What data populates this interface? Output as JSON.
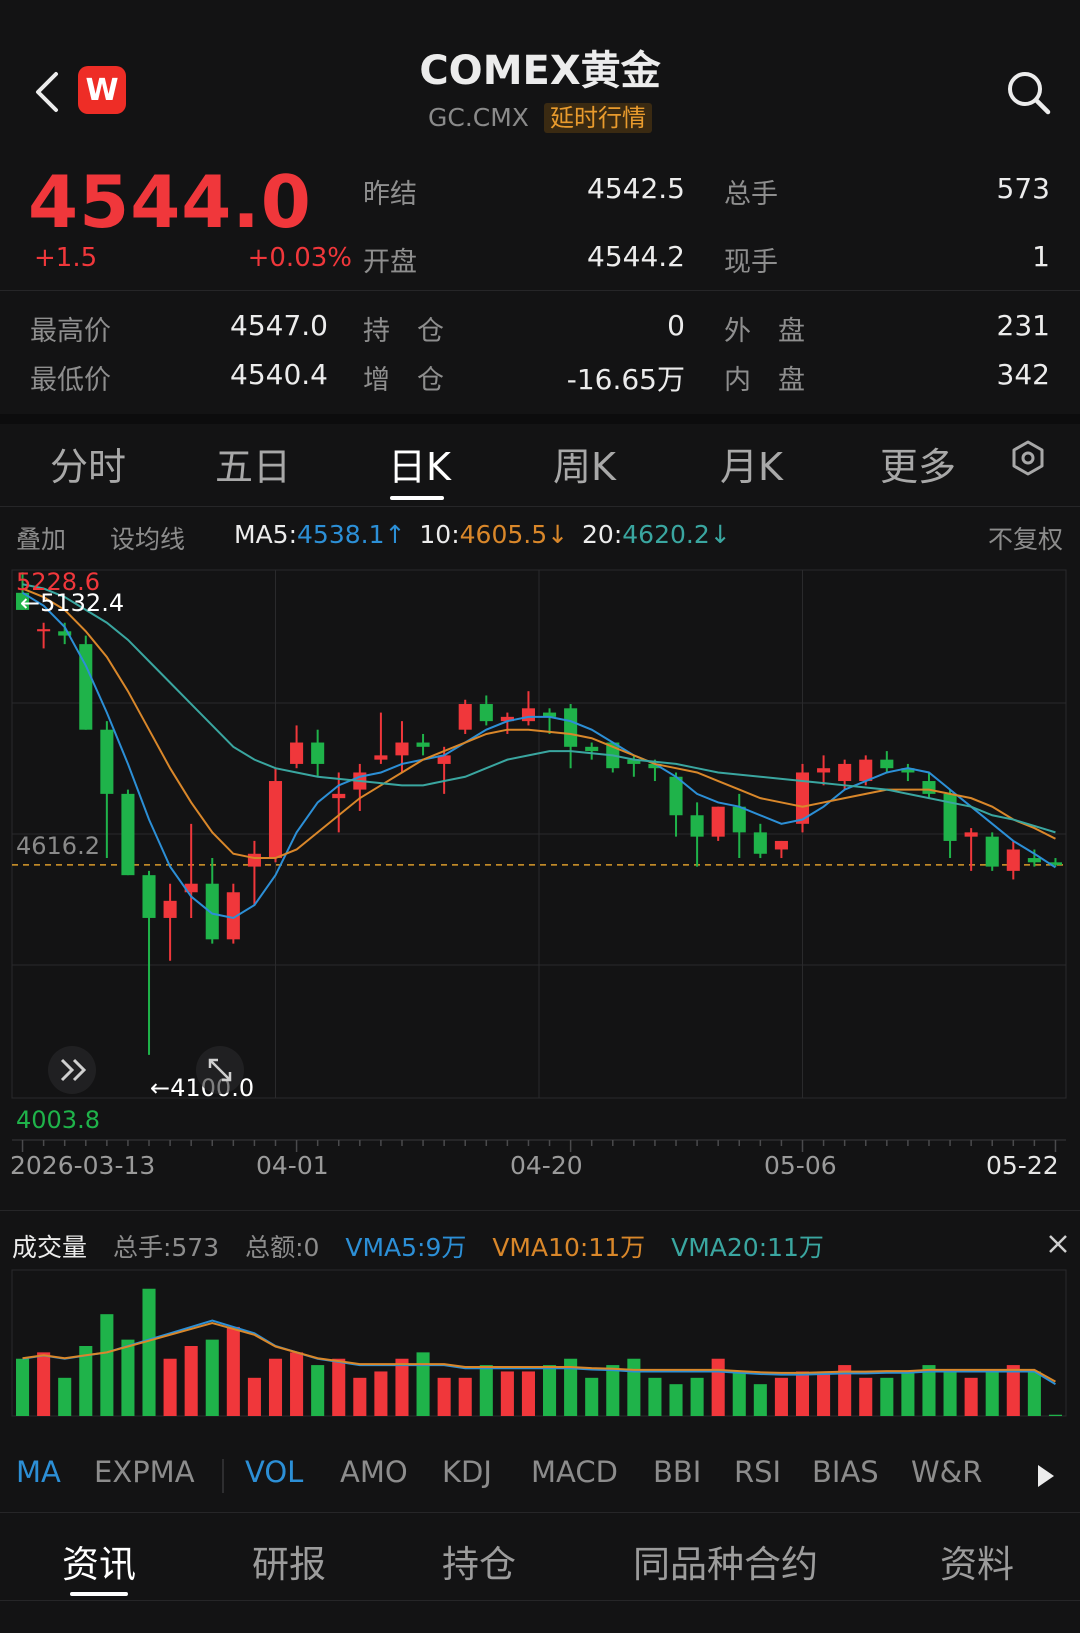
{
  "header": {
    "title": "COMEX黄金",
    "code": "GC.CMX",
    "delay_tag": "延时行情",
    "logo_letter": "W",
    "back_icon": "back-arrow-icon",
    "search_icon": "search-icon"
  },
  "quote": {
    "price": "4544.0",
    "change": "+1.5",
    "change_pct": "+0.03%",
    "rows": [
      {
        "l1": "昨结",
        "v1": "4542.5",
        "l2": "总手",
        "v2": "573"
      },
      {
        "l1": "开盘",
        "v1": "4544.2",
        "l2": "现手",
        "v2": "1"
      }
    ],
    "rows2": [
      {
        "l0": "最高价",
        "v0": "4547.0",
        "l1": "持　仓",
        "v1": "0",
        "l2": "外　盘",
        "v2": "231"
      },
      {
        "l0": "最低价",
        "v0": "4540.4",
        "l1": "增　仓",
        "v1": "-16.65万",
        "l2": "内　盘",
        "v2": "342"
      }
    ]
  },
  "tabs": [
    "分时",
    "五日",
    "日K",
    "周K",
    "月K",
    "更多"
  ],
  "active_tab": "日K",
  "ma_bar": {
    "overlay": "叠加",
    "set_ma": "设均线",
    "ma5_label": "MA5:",
    "ma5_value": "4538.1↑",
    "ma10_label": "10:",
    "ma10_value": "4605.5↓",
    "ma20_label": "20:",
    "ma20_value": "4620.2↓",
    "adjust": "不复权"
  },
  "chart_labels": {
    "top_price": "5228.6",
    "high_marker": "←5132.4",
    "mid_price": "4616.2",
    "low_marker": "←4100.0",
    "bottom_price": "4003.8",
    "dates": [
      "2026-03-13",
      "04-01",
      "04-20",
      "05-06",
      "05-22"
    ]
  },
  "volume_bar": {
    "title": "成交量",
    "total_hands": "总手:573",
    "total_amount": "总额:0",
    "vma5": "VMA5:9万",
    "vma10": "VMA10:11万",
    "vma20": "VMA20:11万",
    "close_icon": "close-icon"
  },
  "indicators": [
    "MA",
    "EXPMA",
    "VOL",
    "AMO",
    "KDJ",
    "MACD",
    "BBI",
    "RSI",
    "BIAS",
    "W&R"
  ],
  "active_indicators": [
    "MA",
    "VOL"
  ],
  "bottom_tabs": [
    "资讯",
    "研报",
    "持仓",
    "同品种合约",
    "资料"
  ],
  "active_bottom_tab": "资讯",
  "colors": {
    "up": "#f0373b",
    "down": "#1fb34a",
    "ma5": "#2c8fd6",
    "ma10": "#d9872a",
    "ma20": "#3aa6a0",
    "background": "#131314"
  },
  "chart_data": {
    "type": "candlestick",
    "x_start": "2026-03-13",
    "x_end": "2026-05-22",
    "y_range": [
      4003.8,
      5228.6
    ],
    "reference_price": 4544.0,
    "candles": [
      {
        "o": 5180,
        "h": 5228,
        "l": 5140,
        "c": 5140
      },
      {
        "o": 5090,
        "h": 5110,
        "l": 5050,
        "c": 5095
      },
      {
        "o": 5090,
        "h": 5110,
        "l": 5060,
        "c": 5080
      },
      {
        "o": 5060,
        "h": 5080,
        "l": 4860,
        "c": 4860
      },
      {
        "o": 4860,
        "h": 4880,
        "l": 4560,
        "c": 4710
      },
      {
        "o": 4710,
        "h": 4720,
        "l": 4520,
        "c": 4520
      },
      {
        "o": 4520,
        "h": 4530,
        "l": 4100,
        "c": 4420
      },
      {
        "o": 4420,
        "h": 4500,
        "l": 4320,
        "c": 4460
      },
      {
        "o": 4480,
        "h": 4640,
        "l": 4420,
        "c": 4500
      },
      {
        "o": 4500,
        "h": 4560,
        "l": 4360,
        "c": 4370
      },
      {
        "o": 4370,
        "h": 4500,
        "l": 4360,
        "c": 4480
      },
      {
        "o": 4540,
        "h": 4600,
        "l": 4450,
        "c": 4570
      },
      {
        "o": 4560,
        "h": 4770,
        "l": 4550,
        "c": 4740
      },
      {
        "o": 4780,
        "h": 4870,
        "l": 4770,
        "c": 4830
      },
      {
        "o": 4830,
        "h": 4860,
        "l": 4750,
        "c": 4780
      },
      {
        "o": 4700,
        "h": 4760,
        "l": 4620,
        "c": 4710
      },
      {
        "o": 4720,
        "h": 4780,
        "l": 4670,
        "c": 4760
      },
      {
        "o": 4790,
        "h": 4900,
        "l": 4780,
        "c": 4800
      },
      {
        "o": 4800,
        "h": 4880,
        "l": 4760,
        "c": 4830
      },
      {
        "o": 4830,
        "h": 4850,
        "l": 4800,
        "c": 4820
      },
      {
        "o": 4780,
        "h": 4820,
        "l": 4710,
        "c": 4800
      },
      {
        "o": 4860,
        "h": 4930,
        "l": 4850,
        "c": 4920
      },
      {
        "o": 4920,
        "h": 4940,
        "l": 4870,
        "c": 4880
      },
      {
        "o": 4880,
        "h": 4900,
        "l": 4850,
        "c": 4890
      },
      {
        "o": 4880,
        "h": 4950,
        "l": 4870,
        "c": 4910
      },
      {
        "o": 4900,
        "h": 4910,
        "l": 4850,
        "c": 4890
      },
      {
        "o": 4910,
        "h": 4920,
        "l": 4770,
        "c": 4820
      },
      {
        "o": 4820,
        "h": 4830,
        "l": 4790,
        "c": 4810
      },
      {
        "o": 4830,
        "h": 4830,
        "l": 4760,
        "c": 4770
      },
      {
        "o": 4790,
        "h": 4800,
        "l": 4750,
        "c": 4780
      },
      {
        "o": 4780,
        "h": 4790,
        "l": 4740,
        "c": 4770
      },
      {
        "o": 4750,
        "h": 4760,
        "l": 4610,
        "c": 4660
      },
      {
        "o": 4660,
        "h": 4690,
        "l": 4540,
        "c": 4610
      },
      {
        "o": 4610,
        "h": 4680,
        "l": 4600,
        "c": 4680
      },
      {
        "o": 4680,
        "h": 4710,
        "l": 4560,
        "c": 4620
      },
      {
        "o": 4620,
        "h": 4640,
        "l": 4560,
        "c": 4570
      },
      {
        "o": 4580,
        "h": 4600,
        "l": 4560,
        "c": 4600
      },
      {
        "o": 4640,
        "h": 4780,
        "l": 4620,
        "c": 4760
      },
      {
        "o": 4760,
        "h": 4800,
        "l": 4730,
        "c": 4770
      },
      {
        "o": 4740,
        "h": 4790,
        "l": 4720,
        "c": 4780
      },
      {
        "o": 4740,
        "h": 4800,
        "l": 4730,
        "c": 4790
      },
      {
        "o": 4790,
        "h": 4810,
        "l": 4760,
        "c": 4770
      },
      {
        "o": 4770,
        "h": 4780,
        "l": 4740,
        "c": 4760
      },
      {
        "o": 4740,
        "h": 4760,
        "l": 4700,
        "c": 4710
      },
      {
        "o": 4710,
        "h": 4720,
        "l": 4560,
        "c": 4600
      },
      {
        "o": 4610,
        "h": 4630,
        "l": 4530,
        "c": 4620
      },
      {
        "o": 4610,
        "h": 4620,
        "l": 4530,
        "c": 4540
      },
      {
        "o": 4530,
        "h": 4600,
        "l": 4510,
        "c": 4580
      },
      {
        "o": 4560,
        "h": 4580,
        "l": 4540,
        "c": 4550
      },
      {
        "o": 4550,
        "h": 4560,
        "l": 4540,
        "c": 4544
      }
    ],
    "ma5": [
      5180,
      5150,
      5100,
      5010,
      4900,
      4780,
      4650,
      4540,
      4470,
      4430,
      4420,
      4450,
      4520,
      4620,
      4690,
      4730,
      4750,
      4760,
      4780,
      4790,
      4800,
      4830,
      4860,
      4880,
      4890,
      4890,
      4880,
      4860,
      4830,
      4800,
      4780,
      4750,
      4710,
      4690,
      4680,
      4660,
      4640,
      4650,
      4680,
      4720,
      4740,
      4760,
      4770,
      4760,
      4720,
      4680,
      4640,
      4600,
      4570,
      4538
    ],
    "ma10": [
      5190,
      5170,
      5140,
      5090,
      5030,
      4950,
      4860,
      4770,
      4690,
      4620,
      4570,
      4560,
      4560,
      4580,
      4620,
      4660,
      4700,
      4730,
      4760,
      4790,
      4810,
      4830,
      4850,
      4860,
      4860,
      4855,
      4850,
      4840,
      4820,
      4800,
      4780,
      4770,
      4760,
      4740,
      4720,
      4700,
      4690,
      4680,
      4690,
      4700,
      4710,
      4720,
      4720,
      4720,
      4710,
      4700,
      4680,
      4650,
      4630,
      4605
    ],
    "ma20": [
      5200,
      5190,
      5170,
      5140,
      5110,
      5070,
      5020,
      4970,
      4920,
      4870,
      4820,
      4790,
      4770,
      4760,
      4750,
      4745,
      4740,
      4735,
      4730,
      4730,
      4740,
      4750,
      4770,
      4790,
      4800,
      4810,
      4810,
      4805,
      4800,
      4790,
      4785,
      4780,
      4770,
      4760,
      4755,
      4750,
      4745,
      4740,
      4735,
      4730,
      4725,
      4720,
      4710,
      4700,
      4690,
      4680,
      4660,
      4650,
      4635,
      4620
    ],
    "volume": [
      9,
      10,
      6,
      11,
      16,
      12,
      20,
      9,
      11,
      12,
      14,
      6,
      9,
      10,
      8,
      9,
      6,
      7,
      9,
      10,
      6,
      6,
      8,
      7,
      7,
      8,
      9,
      6,
      8,
      9,
      6,
      5,
      6,
      9,
      7,
      5,
      6,
      7,
      7,
      8,
      6,
      6,
      7,
      8,
      7,
      6,
      7,
      8,
      7,
      0.2
    ],
    "vma5": [
      9,
      9.5,
      9,
      9.5,
      10,
      11,
      12,
      13,
      14,
      15,
      14,
      13,
      11,
      10,
      9,
      8.5,
      8,
      8,
      8,
      8,
      8,
      7.5,
      7.5,
      7.5,
      7.5,
      7.5,
      7.5,
      7.3,
      7.2,
      7,
      7,
      7,
      7,
      7,
      6.8,
      6.6,
      6.5,
      6.5,
      6.6,
      6.7,
      6.7,
      6.8,
      6.8,
      7,
      7,
      7,
      7,
      7,
      7,
      5
    ]
  }
}
